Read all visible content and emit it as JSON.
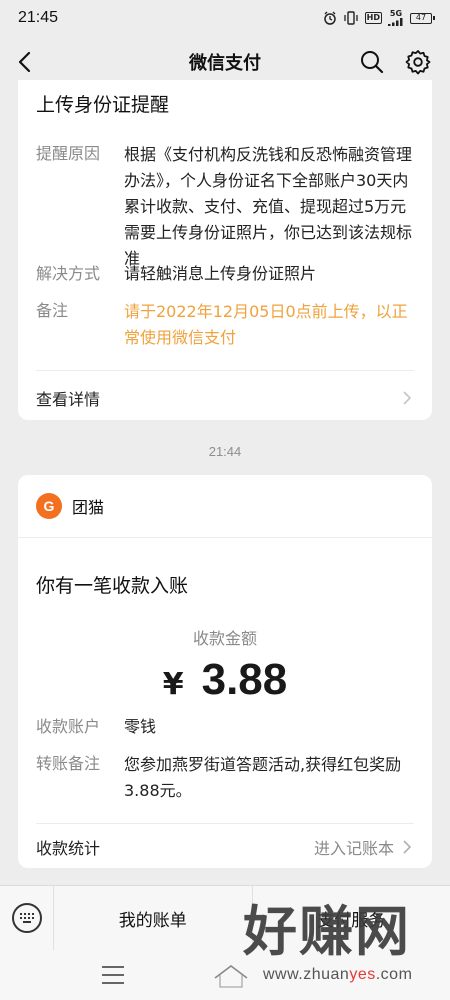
{
  "status_bar": {
    "time": "21:45",
    "icons": [
      "alarm-icon",
      "vibrate-icon",
      "hd-icon",
      "signal-5g-icon",
      "battery-icon"
    ],
    "network": "5G",
    "hd": "HD",
    "battery_level": "47"
  },
  "nav": {
    "title": "微信支付",
    "icons": [
      "back-icon",
      "search-icon",
      "settings-icon"
    ]
  },
  "notice": {
    "title": "上传身份证提醒",
    "reason_label": "提醒原因",
    "reason_value": "根据《支付机构反洗钱和反恐怖融资管理办法》，个人身份证名下全部账户30天内累计收款、支付、充值、提现超过5万元需要上传身份证照片，你已达到该法规标准",
    "method_label": "解决方式",
    "method_value": "请轻触消息上传身份证照片",
    "remark_label": "备注",
    "remark_value": "请于2022年12月05日0点前上传，以正常使用微信支付",
    "detail_link": "查看详情"
  },
  "timestamp": "21:44",
  "receipt": {
    "merchant_name": "团猫",
    "merchant_logo_letter": "G",
    "title": "你有一笔收款入账",
    "amount_label": "收款金额",
    "currency": "¥",
    "amount": "3.88",
    "account_label": "收款账户",
    "account_value": "零钱",
    "memo_label": "转账备注",
    "memo_value": "您参加燕罗街道答题活动,获得红包奖励3.88元。",
    "stats_label": "收款统计",
    "stats_link": "进入记账本"
  },
  "bottom_menu": {
    "items": [
      "我的账单",
      "支付服务"
    ]
  },
  "watermark": {
    "text": "好赚网",
    "url_prefix": "www.zhuan",
    "url_highlight": "yes",
    "url_suffix": ".com"
  },
  "colors": {
    "background": "#ededed",
    "card": "#ffffff",
    "label_gray": "#8a8a8a",
    "warning_orange": "#f0a23c",
    "merchant_orange": "#f37021"
  }
}
